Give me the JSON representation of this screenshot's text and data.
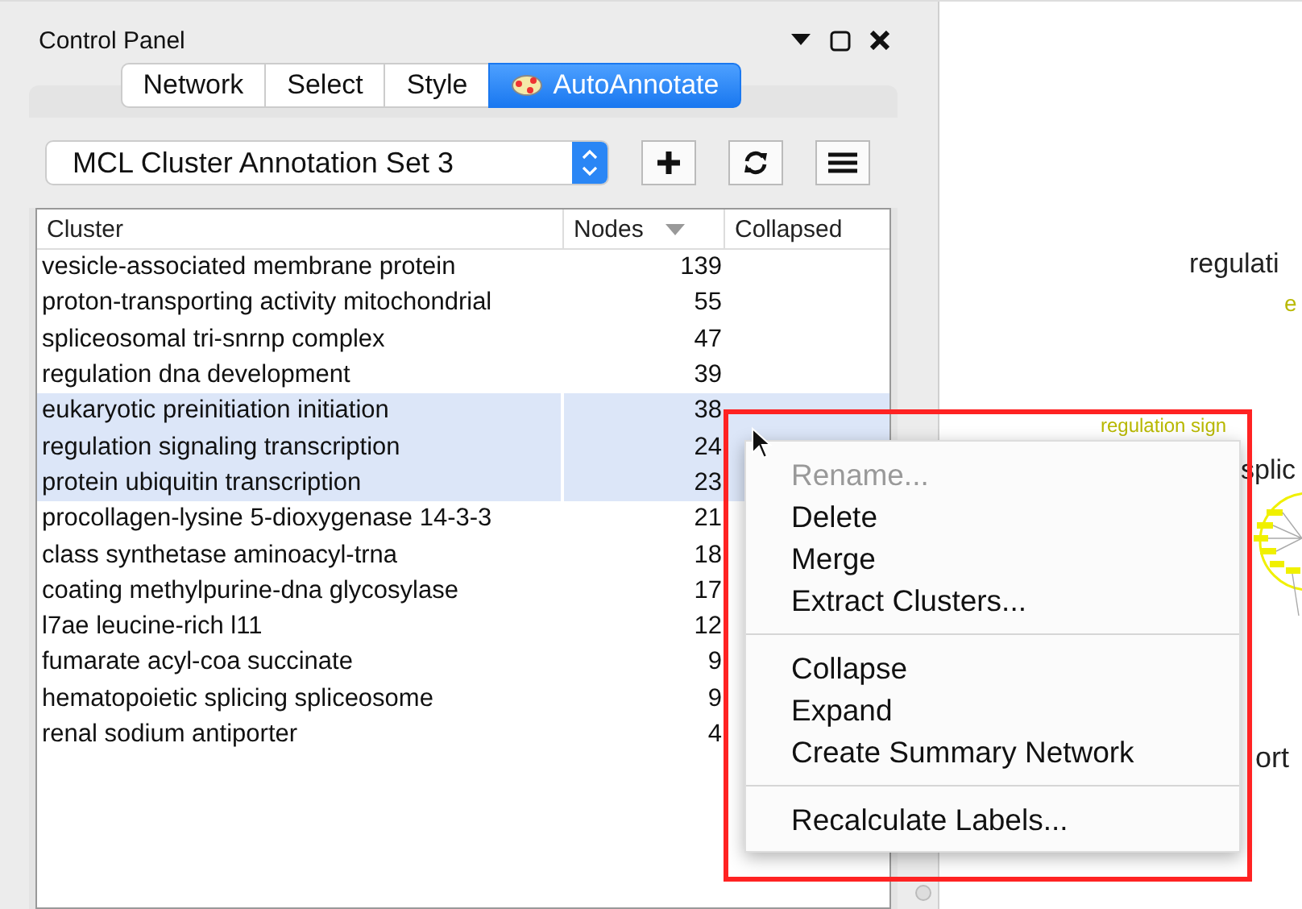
{
  "panel": {
    "title": "Control Panel"
  },
  "tabs": [
    {
      "label": "Network",
      "selected": false
    },
    {
      "label": "Select",
      "selected": false
    },
    {
      "label": "Style",
      "selected": false
    },
    {
      "label": "AutoAnnotate",
      "selected": true
    }
  ],
  "annotation_set": {
    "value": "MCL Cluster Annotation Set 3"
  },
  "table": {
    "columns": [
      {
        "label": "Cluster",
        "sorted": false
      },
      {
        "label": "Nodes",
        "sorted": true
      },
      {
        "label": "Collapsed",
        "sorted": false
      }
    ],
    "rows": [
      {
        "cluster": "vesicle-associated membrane protein",
        "nodes": "139",
        "selected": false
      },
      {
        "cluster": "proton-transporting activity mitochondrial",
        "nodes": "55",
        "selected": false
      },
      {
        "cluster": "spliceosomal tri-snrnp complex",
        "nodes": "47",
        "selected": false
      },
      {
        "cluster": "regulation dna development",
        "nodes": "39",
        "selected": false
      },
      {
        "cluster": "eukaryotic preinitiation initiation",
        "nodes": "38",
        "selected": true
      },
      {
        "cluster": "regulation signaling transcription",
        "nodes": "24",
        "selected": true
      },
      {
        "cluster": "protein ubiquitin transcription",
        "nodes": "23",
        "selected": true
      },
      {
        "cluster": "procollagen-lysine 5-dioxygenase 14-3-3",
        "nodes": "21",
        "selected": false
      },
      {
        "cluster": "class synthetase aminoacyl-trna",
        "nodes": "18",
        "selected": false
      },
      {
        "cluster": "coating methylpurine-dna glycosylase",
        "nodes": "17",
        "selected": false
      },
      {
        "cluster": "l7ae leucine-rich l11",
        "nodes": "12",
        "selected": false
      },
      {
        "cluster": "fumarate acyl-coa succinate",
        "nodes": "9",
        "selected": false
      },
      {
        "cluster": "hematopoietic splicing spliceosome",
        "nodes": "9",
        "selected": false
      },
      {
        "cluster": "renal sodium antiporter",
        "nodes": "4",
        "selected": false
      }
    ]
  },
  "canvas_labels": [
    {
      "text": "regulati",
      "color": "#222222"
    },
    {
      "text": "e",
      "color": "#b8b800"
    },
    {
      "text": "regulation sign",
      "color": "#b8b800"
    },
    {
      "text": "splic",
      "color": "#222222"
    },
    {
      "text": "ort",
      "color": "#222222"
    }
  ],
  "context_menu": {
    "groups": [
      [
        {
          "label": "Rename...",
          "disabled": true
        },
        {
          "label": "Delete",
          "disabled": false
        },
        {
          "label": "Merge",
          "disabled": false
        },
        {
          "label": "Extract Clusters...",
          "disabled": false
        }
      ],
      [
        {
          "label": "Collapse",
          "disabled": false
        },
        {
          "label": "Expand",
          "disabled": false
        },
        {
          "label": "Create Summary Network",
          "disabled": false
        }
      ],
      [
        {
          "label": "Recalculate Labels...",
          "disabled": false
        }
      ]
    ]
  }
}
